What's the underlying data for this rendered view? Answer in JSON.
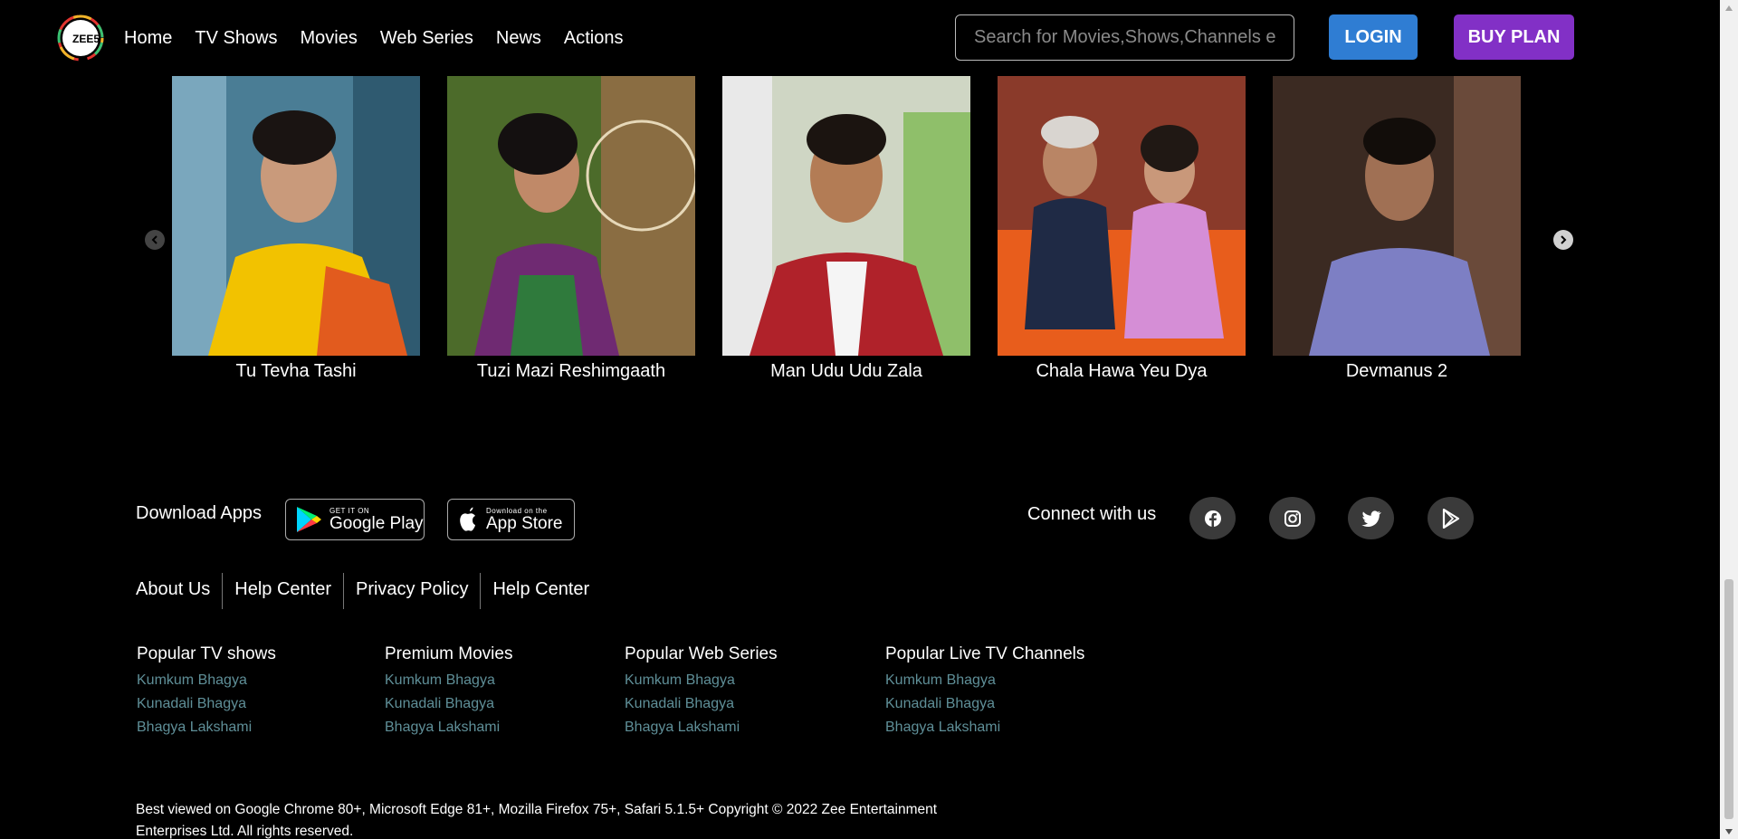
{
  "nav": {
    "logo_text": "ZEE5",
    "links": [
      "Home",
      "TV Shows",
      "Movies",
      "Web Series",
      "News",
      "Actions"
    ],
    "search_placeholder": "Search for Movies,Shows,Channels etc",
    "login_label": "LOGIN",
    "buy_label": "BUY PLAN"
  },
  "carousel": {
    "items": [
      {
        "title": "Tu Tevha Tashi"
      },
      {
        "title": "Tuzi Mazi Reshimgaath"
      },
      {
        "title": "Man Udu Udu Zala"
      },
      {
        "title": "Chala Hawa Yeu Dya"
      },
      {
        "title": "Devmanus 2"
      }
    ]
  },
  "footer": {
    "download_label": "Download Apps",
    "google_play": {
      "small": "GET IT ON",
      "big": "Google Play"
    },
    "app_store": {
      "small": "Download on the",
      "big": "App Store"
    },
    "connect_label": "Connect with us",
    "social_icons": [
      "facebook-icon",
      "instagram-icon",
      "twitter-icon",
      "play-icon"
    ],
    "links": [
      "About Us",
      "Help Center",
      "Privacy Policy",
      "Help Center"
    ],
    "columns": [
      {
        "heading": "Popular TV shows",
        "items": [
          "Kumkum Bhagya",
          "Kunadali Bhagya",
          "Bhagya Lakshami"
        ]
      },
      {
        "heading": "Premium Movies",
        "items": [
          "Kumkum Bhagya",
          "Kunadali Bhagya",
          "Bhagya Lakshami"
        ]
      },
      {
        "heading": "Popular Web Series",
        "items": [
          "Kumkum Bhagya",
          "Kunadali Bhagya",
          "Bhagya Lakshami"
        ]
      },
      {
        "heading": "Popular Live TV Channels",
        "items": [
          "Kumkum Bhagya",
          "Kunadali Bhagya",
          "Bhagya Lakshami"
        ]
      }
    ],
    "copyright": "Best viewed on Google Chrome 80+, Microsoft Edge 81+, Mozilla Firefox 75+, Safari 5.1.5+ Copyright © 2022 Zee Entertainment Enterprises Ltd. All rights reserved."
  },
  "colors": {
    "login_button": "#2f7dd3",
    "buy_button": "#8230c6",
    "footer_link": "#5f8f98"
  }
}
